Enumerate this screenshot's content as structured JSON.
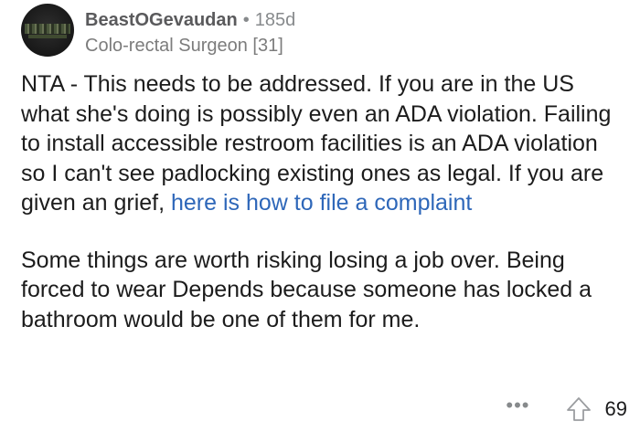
{
  "comment": {
    "username": "BeastOGevaudan",
    "separator": "•",
    "age": "185d",
    "flair": "Colo-rectal Surgeon [31]",
    "paragraph1_text": "NTA - This needs to be addressed. If you are in the US what she's doing is possibly even an ADA violation. Failing to install accessible restroom facilities is an ADA violation so I can't see padlocking existing ones as legal. If you are given an grief, ",
    "paragraph1_link": "here is how to file a complaint",
    "paragraph2": "Some things are worth risking losing a job over. Being forced to wear Depends because someone has locked a bathroom would be one of them for me.",
    "more_label": "•••",
    "upvote_icon": "upvote-arrow-icon",
    "vote_count": "69"
  },
  "colors": {
    "link": "#2e67b9",
    "username": "#5a5a5c",
    "meta": "#878a8c"
  }
}
